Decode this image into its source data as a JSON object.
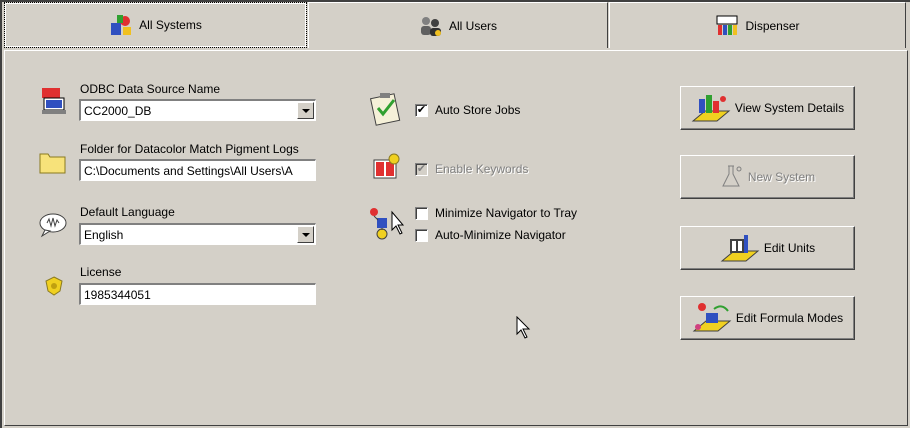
{
  "tabs": [
    {
      "label": "All Systems",
      "icon": "systems-icon",
      "active": true
    },
    {
      "label": "All Users",
      "icon": "users-icon",
      "active": false
    },
    {
      "label": "Dispenser",
      "icon": "dispenser-icon",
      "active": false
    }
  ],
  "fields": {
    "odbc": {
      "label": "ODBC Data Source Name",
      "value": "CC2000_DB"
    },
    "folder": {
      "label": "Folder for Datacolor Match Pigment Logs",
      "value": "C:\\Documents and Settings\\All Users\\A"
    },
    "language": {
      "label": "Default Language",
      "value": "English"
    },
    "license": {
      "label": "License",
      "value": "1985344051"
    }
  },
  "checkboxes": {
    "auto_store": {
      "label": "Auto Store Jobs",
      "checked": true,
      "mark": "✔"
    },
    "enable_keywords": {
      "label": "Enable Keywords",
      "checked": true,
      "disabled": true,
      "mark": "✔"
    },
    "minimize_tray": {
      "label": "Minimize Navigator to Tray",
      "checked": false
    },
    "auto_minimize": {
      "label": "Auto-Minimize Navigator",
      "checked": false
    }
  },
  "buttons": {
    "view_system": {
      "label": "View System Details"
    },
    "new_system": {
      "label": "New System",
      "disabled": true
    },
    "edit_units": {
      "label": "Edit Units"
    },
    "edit_formula": {
      "label": "Edit Formula Modes"
    }
  },
  "colors": {
    "face": "#d4d0c8",
    "highlight": "#ffffff",
    "shadow": "#808080",
    "dark_shadow": "#404040"
  }
}
